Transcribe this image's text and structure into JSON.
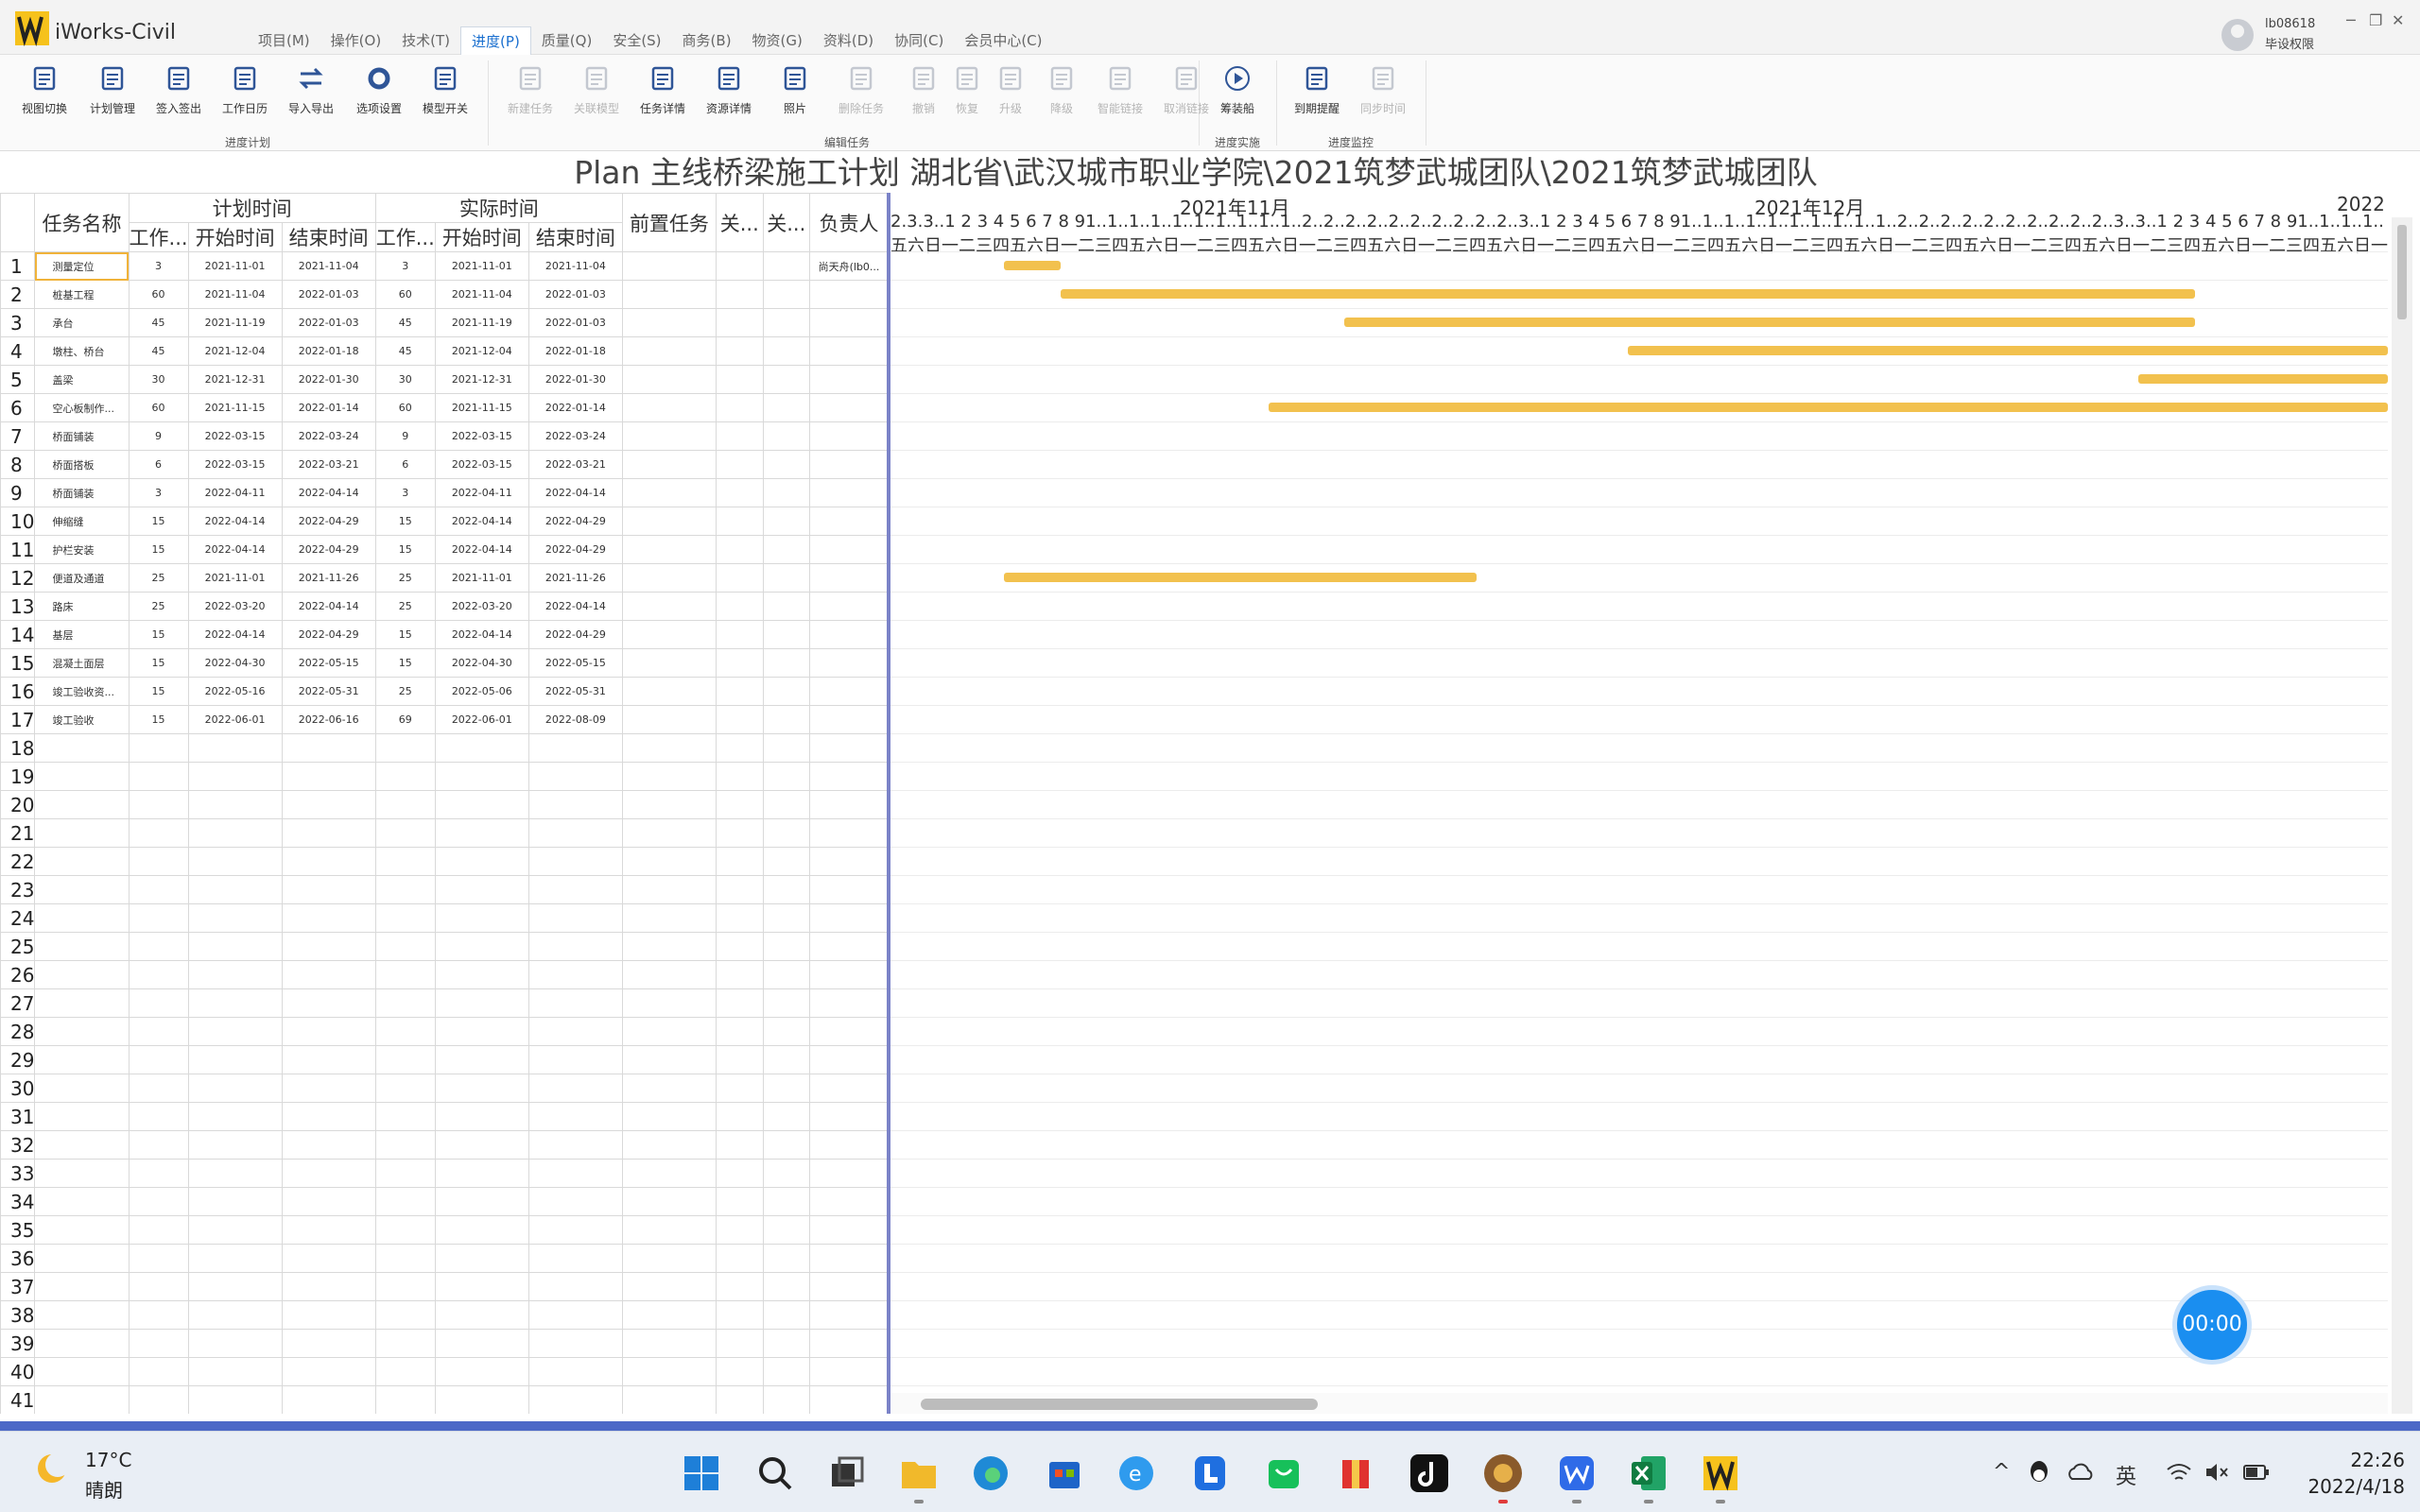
{
  "app": {
    "name": "iWorks-Civil"
  },
  "menu": [
    "项目(M)",
    "操作(O)",
    "技术(T)",
    "进度(P)",
    "质量(Q)",
    "安全(S)",
    "商务(B)",
    "物资(G)",
    "资料(D)",
    "协同(C)",
    "会员中心(C)"
  ],
  "user": {
    "name": "lb08618",
    "role": "毕设权限"
  },
  "window_controls": {
    "minimize": "─",
    "restore": "❐",
    "close": "✕"
  },
  "ribbon": {
    "buttons": [
      {
        "label": "视图切换"
      },
      {
        "label": "计划管理"
      },
      {
        "label": "签入签出"
      },
      {
        "label": "工作日历"
      },
      {
        "label": "导入导出"
      },
      {
        "label": "选项设置"
      },
      {
        "label": "模型开关"
      },
      {
        "label": "新建任务"
      },
      {
        "label": "关联模型"
      },
      {
        "label": "任务详情"
      },
      {
        "label": "资源详情"
      },
      {
        "label": "照片"
      },
      {
        "label": "删除任务"
      },
      {
        "label": "撤销"
      },
      {
        "label": "恢复"
      },
      {
        "label": "升级"
      },
      {
        "label": "降级"
      },
      {
        "label": "智能链接"
      },
      {
        "label": "取消链接"
      },
      {
        "label": "筹装船"
      },
      {
        "label": "到期提醒"
      },
      {
        "label": "同步时间"
      }
    ],
    "groups": [
      "进度计划",
      "编辑任务",
      "进度实施",
      "进度监控"
    ]
  },
  "title": "Plan 主线桥梁施工计划 湖北省\\武汉城市职业学院\\2021筑梦武城团队\\2021筑梦武城团队",
  "grid": {
    "header_top": {
      "name": "任务名称",
      "plan": "计划时间",
      "actual": "实际时间",
      "pred": "前置任务",
      "rel1": "关...",
      "rel2": "关...",
      "owner": "负责人"
    },
    "header_sub": {
      "p_work": "工作...",
      "p_start": "开始时间",
      "p_end": "结束时间",
      "a_work": "工作...",
      "a_start": "开始时间",
      "a_end": "结束时间"
    },
    "rows": [
      {
        "n": "1",
        "name": "测量定位",
        "pw": "3",
        "ps": "2021-11-01",
        "pe": "2021-11-04",
        "aw": "3",
        "as": "2021-11-01",
        "ae": "2021-11-04",
        "owner": "尚天舟(lb0..."
      },
      {
        "n": "2",
        "name": "桩基工程",
        "pw": "60",
        "ps": "2021-11-04",
        "pe": "2022-01-03",
        "aw": "60",
        "as": "2021-11-04",
        "ae": "2022-01-03",
        "owner": ""
      },
      {
        "n": "3",
        "name": "承台",
        "pw": "45",
        "ps": "2021-11-19",
        "pe": "2022-01-03",
        "aw": "45",
        "as": "2021-11-19",
        "ae": "2022-01-03",
        "owner": ""
      },
      {
        "n": "4",
        "name": "墩柱、桥台",
        "pw": "45",
        "ps": "2021-12-04",
        "pe": "2022-01-18",
        "aw": "45",
        "as": "2021-12-04",
        "ae": "2022-01-18",
        "owner": ""
      },
      {
        "n": "5",
        "name": "盖梁",
        "pw": "30",
        "ps": "2021-12-31",
        "pe": "2022-01-30",
        "aw": "30",
        "as": "2021-12-31",
        "ae": "2022-01-30",
        "owner": ""
      },
      {
        "n": "6",
        "name": "空心板制作...",
        "pw": "60",
        "ps": "2021-11-15",
        "pe": "2022-01-14",
        "aw": "60",
        "as": "2021-11-15",
        "ae": "2022-01-14",
        "owner": ""
      },
      {
        "n": "7",
        "name": "桥面铺装",
        "pw": "9",
        "ps": "2022-03-15",
        "pe": "2022-03-24",
        "aw": "9",
        "as": "2022-03-15",
        "ae": "2022-03-24",
        "owner": ""
      },
      {
        "n": "8",
        "name": "桥面搭板",
        "pw": "6",
        "ps": "2022-03-15",
        "pe": "2022-03-21",
        "aw": "6",
        "as": "2022-03-15",
        "ae": "2022-03-21",
        "owner": ""
      },
      {
        "n": "9",
        "name": "桥面铺装",
        "pw": "3",
        "ps": "2022-04-11",
        "pe": "2022-04-14",
        "aw": "3",
        "as": "2022-04-11",
        "ae": "2022-04-14",
        "owner": ""
      },
      {
        "n": "10",
        "name": "伸缩缝",
        "pw": "15",
        "ps": "2022-04-14",
        "pe": "2022-04-29",
        "aw": "15",
        "as": "2022-04-14",
        "ae": "2022-04-29",
        "owner": ""
      },
      {
        "n": "11",
        "name": "护栏安装",
        "pw": "15",
        "ps": "2022-04-14",
        "pe": "2022-04-29",
        "aw": "15",
        "as": "2022-04-14",
        "ae": "2022-04-29",
        "owner": ""
      },
      {
        "n": "12",
        "name": "便道及通道",
        "pw": "25",
        "ps": "2021-11-01",
        "pe": "2021-11-26",
        "aw": "25",
        "as": "2021-11-01",
        "ae": "2021-11-26",
        "owner": ""
      },
      {
        "n": "13",
        "name": "路床",
        "pw": "25",
        "ps": "2022-03-20",
        "pe": "2022-04-14",
        "aw": "25",
        "as": "2022-03-20",
        "ae": "2022-04-14",
        "owner": ""
      },
      {
        "n": "14",
        "name": "基层",
        "pw": "15",
        "ps": "2022-04-14",
        "pe": "2022-04-29",
        "aw": "15",
        "as": "2022-04-14",
        "ae": "2022-04-29",
        "owner": ""
      },
      {
        "n": "15",
        "name": "混凝土面层",
        "pw": "15",
        "ps": "2022-04-30",
        "pe": "2022-05-15",
        "aw": "15",
        "as": "2022-04-30",
        "ae": "2022-05-15",
        "owner": ""
      },
      {
        "n": "16",
        "name": "竣工验收资...",
        "pw": "15",
        "ps": "2022-05-16",
        "pe": "2022-05-31",
        "aw": "25",
        "as": "2022-05-06",
        "ae": "2022-05-31",
        "owner": ""
      },
      {
        "n": "17",
        "name": "竣工验收",
        "pw": "15",
        "ps": "2022-06-01",
        "pe": "2022-06-16",
        "aw": "69",
        "as": "2022-06-01",
        "ae": "2022-08-09",
        "owner": ""
      }
    ],
    "empty_rows": [
      "18",
      "19",
      "20",
      "21",
      "22",
      "23",
      "24",
      "25",
      "26",
      "27",
      "28",
      "29",
      "30",
      "31",
      "32",
      "33",
      "34",
      "35",
      "36",
      "37",
      "38",
      "39",
      "40",
      "41"
    ]
  },
  "timeline": {
    "months": [
      "2021年11月",
      "2021年12月",
      "2022"
    ],
    "days_row": "2.3.3..1 2 3 4 5 6 7 8 91..1..1..1..1..1..1..1..1..1..2..2..2..2..2..2..2..2..2..2..3..1 2 3 4 5 6 7 8 91..1..1..1..1..1..1..1..1..1..2..2..2..2..2..2..2..2..2..2..3..3..1 2 3 4 5 6 7 8 91..1..1..1..",
    "weekday_row": "五六日一二三四五六日一二三四五六日一二三四五六日一二三四五六日一二三四五六日一二三四五六日一二三四五六日一二三四五六日一二三四五六日一二三四五六日一二三四五六日一二三四五六日一二三四五六"
  },
  "gantt_bars": [
    {
      "row": 1,
      "start": "2021-11-01",
      "end": "2021-11-04"
    },
    {
      "row": 2,
      "start": "2021-11-04",
      "end": "2022-01-03"
    },
    {
      "row": 3,
      "start": "2021-11-19",
      "end": "2022-01-03"
    },
    {
      "row": 4,
      "start": "2021-12-04",
      "end": "2022-01-18"
    },
    {
      "row": 5,
      "start": "2021-12-31",
      "end": "2022-01-30"
    },
    {
      "row": 6,
      "start": "2021-11-15",
      "end": "2022-01-14"
    },
    {
      "row": 12,
      "start": "2021-11-01",
      "end": "2021-11-26"
    }
  ],
  "bar_color": "#f2c14e",
  "timer": "00:00",
  "taskbar": {
    "weather_temp": "17°C",
    "weather_cond": "晴朗",
    "tray_lang": "英",
    "time": "22:26",
    "date": "2022/4/18"
  }
}
